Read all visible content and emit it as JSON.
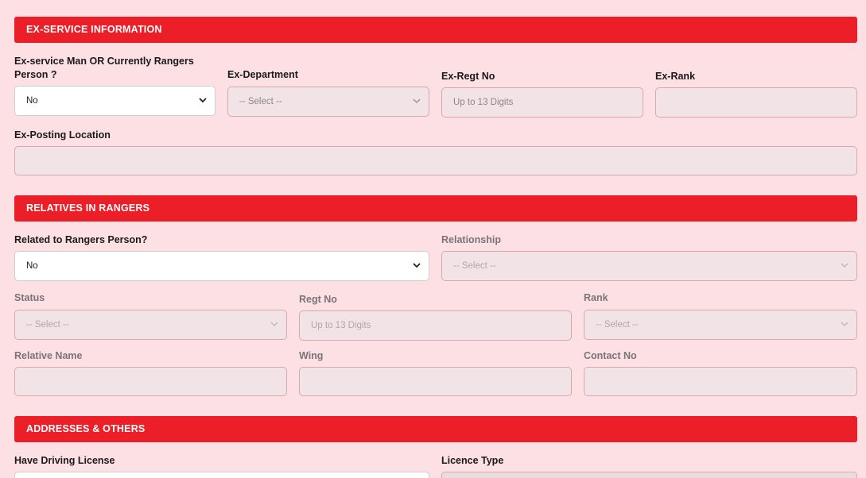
{
  "sections": {
    "ex_service": "EX-SERVICE INFORMATION",
    "relatives": "RELATIVES IN RANGERS",
    "addresses": "ADDRESSES & OTHERS"
  },
  "ex_service": {
    "is_ex_service_label_1": "Ex-service Man OR Currently Rangers",
    "is_ex_service_label_2": "Person ?",
    "is_ex_service_value": "No",
    "department_label": "Ex-Department",
    "department_value": "-- Select --",
    "regt_no_label": "Ex-Regt No",
    "regt_no_placeholder": "Up to 13 Digits",
    "rank_label": "Ex-Rank",
    "rank_value": "",
    "posting_location_label": "Ex-Posting Location",
    "posting_location_value": ""
  },
  "relatives": {
    "related_label": "Related to Rangers Person?",
    "related_value": "No",
    "relationship_label": "Relationship",
    "relationship_value": "-- Select --",
    "status_label": "Status",
    "status_value": "-- Select --",
    "regt_no_label": "Regt No",
    "regt_no_placeholder": "Up to 13 Digits",
    "rank_label": "Rank",
    "rank_value": "-- Select --",
    "relative_name_label": "Relative Name",
    "wing_label": "Wing",
    "contact_no_label": "Contact No"
  },
  "addresses": {
    "driving_license_label": "Have Driving License",
    "licence_type_label": "Licence Type"
  },
  "colors": {
    "header_bar": "#ec1e27",
    "background": "#fde0e4"
  },
  "icons": {
    "select_arrow": "chevron-down-icon"
  }
}
